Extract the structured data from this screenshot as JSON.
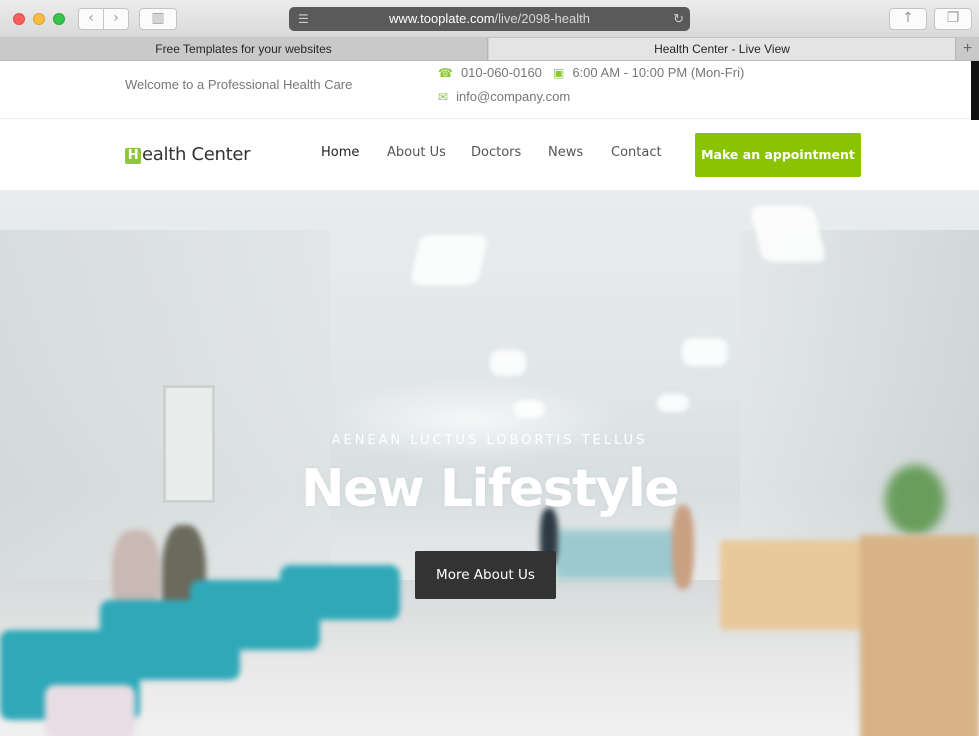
{
  "browser": {
    "address": {
      "domain": "www.tooplate.com",
      "path": "/live/2098-health"
    },
    "tabs": [
      {
        "label": "Free Templates for your websites"
      },
      {
        "label": "Health Center - Live View"
      }
    ]
  },
  "topbar": {
    "welcome": "Welcome to a Professional Health Care",
    "phone": "010-060-0160",
    "hours": "6:00 AM - 10:00 PM (Mon-Fri)",
    "email": "info@company.com"
  },
  "nav": {
    "logo_letter": "H",
    "logo_rest": "ealth Center",
    "items": [
      "Home",
      "About Us",
      "Doctors",
      "News",
      "Contact"
    ],
    "cta": "Make an appointment"
  },
  "hero": {
    "kicker": "AENEAN LUCTUS LOBORTIS TELLUS",
    "title": "New Lifestyle",
    "button": "More About Us"
  },
  "colors": {
    "accent": "#8ac300",
    "dark_button": "#333333"
  },
  "icons": [
    "phone-icon",
    "calendar-icon",
    "envelope-icon",
    "reader-icon",
    "reload-icon",
    "share-icon",
    "tabs-icon",
    "sidebar-icon"
  ]
}
